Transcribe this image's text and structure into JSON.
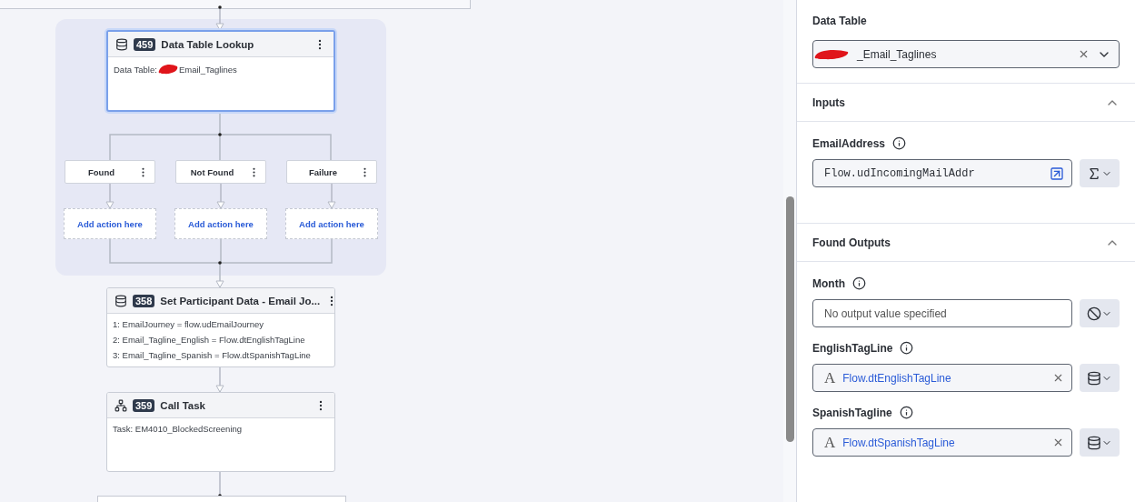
{
  "canvas": {
    "group": {
      "node": {
        "number": "459",
        "title": "Data Table Lookup",
        "kind": "database",
        "selected": true,
        "body": {
          "label": "Data Table:",
          "value": "Email_Taglines",
          "redacted": true
        }
      },
      "branches": [
        {
          "label": "Found",
          "placeholder": "Add action here"
        },
        {
          "label": "Not Found",
          "placeholder": "Add action here"
        },
        {
          "label": "Failure",
          "placeholder": "Add action here"
        }
      ]
    },
    "nodes": [
      {
        "number": "358",
        "title": "Set Participant Data - Email Jo...",
        "kind": "database",
        "selected": false,
        "lines": [
          "1: EmailJourney = flow.udEmailJourney",
          "2: Email_Tagline_English = Flow.dtEnglishTagLine",
          "3: Email_Tagline_Spanish = Flow.dtSpanishTagLine"
        ]
      },
      {
        "number": "359",
        "title": "Call Task",
        "kind": "hierarchy",
        "selected": false,
        "lines": [
          "Task: EM4010_BlockedScreening"
        ]
      }
    ]
  },
  "panel": {
    "data_table": {
      "label": "Data Table",
      "value": "_Email_Taglines",
      "redacted": true
    },
    "sections": [
      {
        "title": "Inputs",
        "expanded": true,
        "fields": [
          {
            "label": "EmailAddress",
            "kind": "expression",
            "value": "Flow.udIncomingMailAddr"
          }
        ]
      },
      {
        "title": "Found Outputs",
        "expanded": true,
        "fields": [
          {
            "label": "Month",
            "kind": "empty",
            "placeholder": "No output value specified"
          },
          {
            "label": "EnglishTagLine",
            "kind": "variable",
            "type_glyph": "A",
            "value": "Flow.dtEnglishTagLine"
          },
          {
            "label": "SpanishTagline",
            "kind": "variable",
            "type_glyph": "A",
            "value": "Flow.dtSpanishTagLine"
          }
        ]
      }
    ]
  }
}
